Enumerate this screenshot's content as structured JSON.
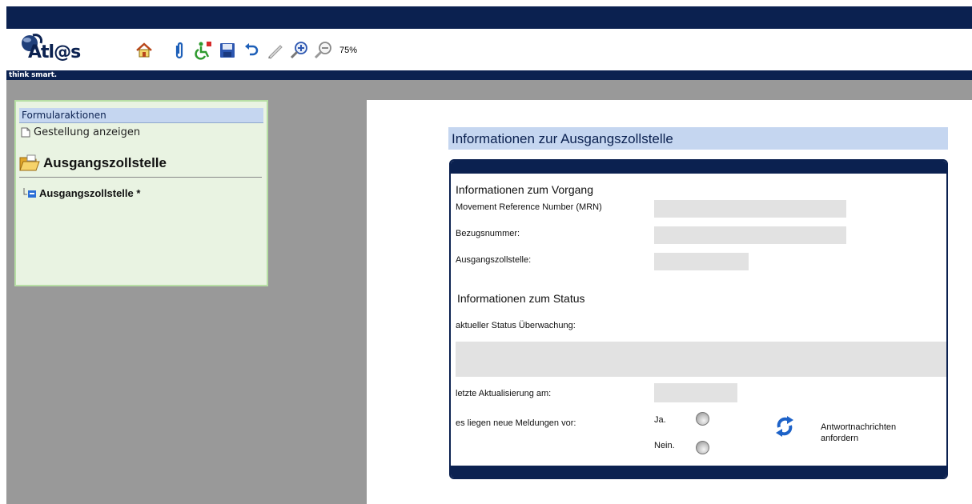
{
  "app": {
    "logo_text": "Atl@s",
    "tagline": "think smart.",
    "zoom": "75%",
    "toolbar_icons": [
      "home-icon",
      "paperclip-icon",
      "wheelchair-icon",
      "save-icon",
      "undo-icon",
      "pencil-icon",
      "zoom-in-icon",
      "zoom-out-icon"
    ]
  },
  "sidebar": {
    "header": "Formularaktionen",
    "action_link": "Gestellung anzeigen",
    "section_title": "Ausgangszollstelle",
    "tree_item": "Ausgangszollstelle *"
  },
  "form": {
    "title": "Informationen zur Ausgangszollstelle",
    "section_vorgang": "Informationen zum Vorgang",
    "mrn_label": "Movement Reference Number (MRN)",
    "mrn_value": "",
    "bezug_label": "Bezugsnummer:",
    "bezug_value": "",
    "zollstelle_label": "Ausgangszollstelle:",
    "zollstelle_value": "",
    "section_status": "Informationen zum Status",
    "status_label": "aktueller Status Überwachung:",
    "status_value": "",
    "updated_label": "letzte Aktualisierung am:",
    "updated_value": "",
    "new_msgs_label": "es liegen neue Meldungen vor:",
    "yes_label": "Ja.",
    "no_label": "Nein.",
    "request_label_line1": "Antwortnachrichten",
    "request_label_line2": "anfordern"
  },
  "colors": {
    "navy": "#0b2150",
    "header_blue": "#c5d6f0",
    "sidebar_bg": "#e9f3e2",
    "sidebar_border": "#b6dea4",
    "field_gray": "#e2e2e2"
  }
}
